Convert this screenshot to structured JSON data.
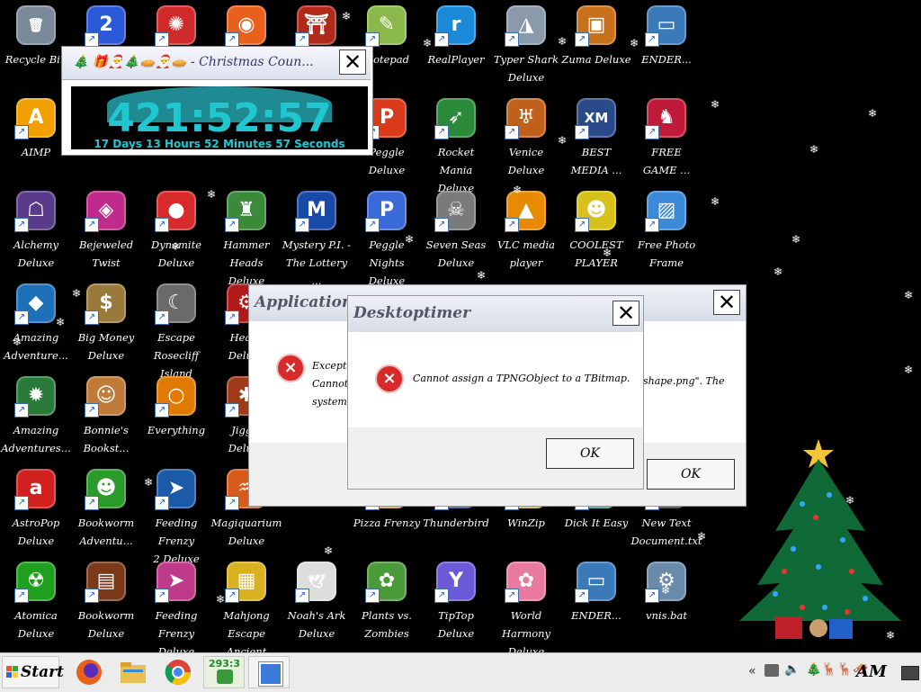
{
  "desktop": {
    "icons": [
      {
        "label": "Recycle Bin",
        "icon": "recycle-bin-icon",
        "color": "#7a8a99",
        "glyph": "🗑"
      },
      {
        "label": "AIMP",
        "icon": "aimp-icon",
        "color": "#f2a000",
        "glyph": "A"
      },
      {
        "label": "Alchemy\nDeluxe",
        "icon": "alchemy-icon",
        "color": "#5a3a8a",
        "glyph": "☖"
      },
      {
        "label": "Amazing\nAdventure...",
        "icon": "amazing-adventures-icon",
        "color": "#1d6fb8",
        "glyph": "◆"
      },
      {
        "label": "Amazing\nAdventures...",
        "icon": "amazing-adventures-2-icon",
        "color": "#2a7a3a",
        "glyph": "✹"
      },
      {
        "label": "AstroPop\nDeluxe",
        "icon": "astropop-icon",
        "color": "#d02020",
        "glyph": "a"
      },
      {
        "label": "Atomica Deluxe",
        "icon": "atomica-icon",
        "color": "#1ea01e",
        "glyph": "☢"
      },
      {
        "label": "",
        "icon": "blue-game-2-icon",
        "color": "#2a5ad8",
        "glyph": "2"
      },
      {
        "label": "Bejeweled Twist",
        "icon": "bejeweled-twist-icon",
        "color": "#c02a8a",
        "glyph": "◈"
      },
      {
        "label": "Big Money\nDeluxe",
        "icon": "big-money-icon",
        "color": "#9a7a3a",
        "glyph": "$"
      },
      {
        "label": "Bonnie's\nBookst...",
        "icon": "bonnies-bookstore-icon",
        "color": "#c07a3a",
        "glyph": "☺"
      },
      {
        "label": "Bookworm\nAdventu...",
        "icon": "bookworm-adventures-icon",
        "color": "#2a9a2a",
        "glyph": "☻"
      },
      {
        "label": "Bookworm\nDeluxe",
        "icon": "bookworm-deluxe-icon",
        "color": "#7a3a1a",
        "glyph": "▤"
      },
      {
        "label": "",
        "icon": "red-fuzzy-icon",
        "color": "#d02a2a",
        "glyph": "✺"
      },
      {
        "label": "Dynomite\nDeluxe",
        "icon": "dynomite-icon",
        "color": "#d82a2a",
        "glyph": "●"
      },
      {
        "label": "Escape\nRosecliff Island",
        "icon": "escape-rosecliff-icon",
        "color": "#6a6a6a",
        "glyph": "☾"
      },
      {
        "label": "Everything",
        "icon": "everything-icon",
        "color": "#e07a00",
        "glyph": "○"
      },
      {
        "label": "Feeding Frenzy\n2 Deluxe",
        "icon": "feeding-frenzy-2-icon",
        "color": "#1a5aa8",
        "glyph": "➤"
      },
      {
        "label": "Feeding Frenzy\nDeluxe",
        "icon": "feeding-frenzy-icon",
        "color": "#c03a8a",
        "glyph": "➤"
      },
      {
        "label": "",
        "icon": "firefox-icon",
        "color": "#e8601c",
        "glyph": "◉"
      },
      {
        "label": "Hammer Heads\nDeluxe",
        "icon": "hammer-heads-icon",
        "color": "#3a8a3a",
        "glyph": "♜"
      },
      {
        "label": "Heavy\nDeluxe",
        "icon": "heavy-weapon-icon",
        "color": "#b01a1a",
        "glyph": "⚙"
      },
      {
        "label": "Jiggle\nDeluxe",
        "icon": "jiggle-icon",
        "color": "#a03a1a",
        "glyph": "✱"
      },
      {
        "label": "Magiquarium\nDeluxe",
        "icon": "magiquarium-icon",
        "color": "#d85a1a",
        "glyph": "♒"
      },
      {
        "label": "Mahjong Escape\nAncient China",
        "icon": "mahjong-escape-icon",
        "color": "#d8b020",
        "glyph": "▦"
      },
      {
        "label": "",
        "icon": "shrine-icon",
        "color": "#b02a1a",
        "glyph": "⛩"
      },
      {
        "label": "Mystery P.I. -\nThe Lottery ...",
        "icon": "mystery-pi-icon",
        "color": "#1a4aa8",
        "glyph": "M"
      },
      {
        "label": "Noah's Ark\nDeluxe",
        "icon": "noahs-ark-icon",
        "color": "#dddddd",
        "glyph": "🕊"
      },
      {
        "label": "Notepad",
        "icon": "notepad-icon",
        "color": "#8ab84a",
        "glyph": "✎"
      },
      {
        "label": "Peggle Deluxe",
        "icon": "peggle-deluxe-icon",
        "color": "#d83a1a",
        "glyph": "P"
      },
      {
        "label": "Peggle Nights\nDeluxe",
        "icon": "peggle-nights-icon",
        "color": "#3a6ad8",
        "glyph": "P"
      },
      {
        "label": "Pizza Frenzy",
        "icon": "pizza-frenzy-icon",
        "color": "#d8a01a",
        "glyph": "◍"
      },
      {
        "label": "Plants vs.\nZombies",
        "icon": "plants-vs-zombies-icon",
        "color": "#4a9a3a",
        "glyph": "✿"
      },
      {
        "label": "RealPlayer",
        "icon": "realplayer-icon",
        "color": "#1a8ad8",
        "glyph": "r"
      },
      {
        "label": "Rocket Mania\nDeluxe",
        "icon": "rocket-mania-icon",
        "color": "#2a8a3a",
        "glyph": "➶"
      },
      {
        "label": "Seven Seas\nDeluxe",
        "icon": "seven-seas-icon",
        "color": "#7a7a7a",
        "glyph": "☠"
      },
      {
        "label": "Thunderbird",
        "icon": "thunderbird-icon",
        "color": "#1a4a8a",
        "glyph": "✉"
      },
      {
        "label": "TipTop Deluxe",
        "icon": "tiptop-icon",
        "color": "#6a5ad8",
        "glyph": "Y"
      },
      {
        "label": "Typer Shark\nDeluxe",
        "icon": "typer-shark-icon",
        "color": "#8a9aaa",
        "glyph": "◮"
      },
      {
        "label": "Venice Deluxe",
        "icon": "venice-icon",
        "color": "#c0601a",
        "glyph": "♅"
      },
      {
        "label": "VLC media\nplayer",
        "icon": "vlc-icon",
        "color": "#e88a00",
        "glyph": "▲"
      },
      {
        "label": "WinZip",
        "icon": "winzip-icon",
        "color": "#d8b01a",
        "glyph": "Z"
      },
      {
        "label": "World Harmony\nDeluxe",
        "icon": "world-harmony-icon",
        "color": "#e87aa0",
        "glyph": "✿"
      },
      {
        "label": "Zuma Deluxe",
        "icon": "zuma-icon",
        "color": "#c8701a",
        "glyph": "▣"
      },
      {
        "label": "BEST\nMEDIA ...",
        "icon": "xmplay-icon",
        "color": "#2a4a8a",
        "glyph": "XM"
      },
      {
        "label": "COOLEST\nPLAYER",
        "icon": "coolest-player-icon",
        "color": "#d8c01a",
        "glyph": "☻"
      },
      {
        "label": "Dick It Easy",
        "icon": "dick-it-easy-icon",
        "color": "#1aa0a0",
        "glyph": "▭"
      },
      {
        "label": "ENDER...",
        "icon": "ender-2-icon",
        "color": "#3a7ab8",
        "glyph": "▭"
      },
      {
        "label": "ENDER...",
        "icon": "ender-icon",
        "color": "#3a7ab8",
        "glyph": "▭"
      },
      {
        "label": "FREE\nGAME ...",
        "icon": "free-game-icon",
        "color": "#c01a3a",
        "glyph": "♞"
      },
      {
        "label": "Free Photo\nFrame",
        "icon": "free-photo-frame-icon",
        "color": "#3a8ad8",
        "glyph": "▨"
      },
      {
        "label": "New Text\nDocument.txt",
        "icon": "new-text-document-icon",
        "color": "#2a2a2a",
        "glyph": ""
      },
      {
        "label": "vnis.bat",
        "icon": "vnis-bat-icon",
        "color": "#6a8aaa",
        "glyph": "⚙"
      }
    ]
  },
  "countdown": {
    "title": "🎄 🎁🎅🎄🥧🎅🥧 - Christmas Coun...",
    "time": "421:52:57",
    "subtitle": "17 Days 13 Hours 52 Minutes 57 Seconds",
    "close": "✕"
  },
  "app_error": {
    "title": "Application Erro...",
    "message": "Exception\nCannot a\nsystem ca",
    "message_tail": "shape.png\". The",
    "ok": "OK",
    "close": "✕"
  },
  "desktoptimer": {
    "title": "Desktoptimer",
    "message": "Cannot assign a TPNGObject to a TBitmap.",
    "ok": "OK",
    "close": "✕"
  },
  "taskbar": {
    "start": "Start",
    "timer_badge": "293:3",
    "clock": "AM",
    "tray_chevron": "«"
  }
}
